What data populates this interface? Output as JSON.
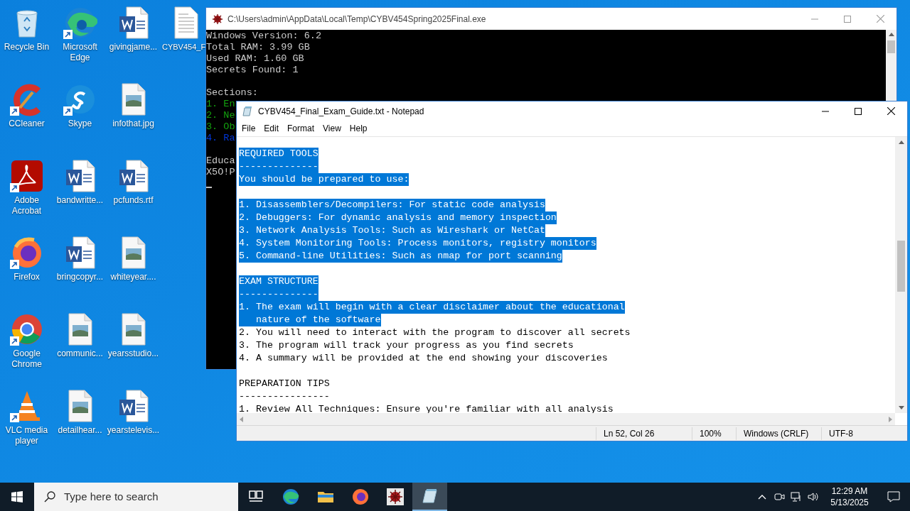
{
  "desktop_icons": [
    {
      "label": "Recycle Bin",
      "kind": "recycle",
      "shortcut": false
    },
    {
      "label": "CCleaner",
      "kind": "ccleaner",
      "shortcut": true
    },
    {
      "label": "Adobe Acrobat",
      "kind": "acrobat",
      "shortcut": true
    },
    {
      "label": "Firefox",
      "kind": "firefox",
      "shortcut": true
    },
    {
      "label": "Google Chrome",
      "kind": "chrome",
      "shortcut": true
    },
    {
      "label": "VLC media player",
      "kind": "vlc",
      "shortcut": true
    },
    {
      "label": "Microsoft Edge",
      "kind": "edge",
      "shortcut": true
    },
    {
      "label": "Skype",
      "kind": "skype",
      "shortcut": true
    },
    {
      "label": "bandwritte...",
      "kind": "word",
      "shortcut": false
    },
    {
      "label": "bringcopyr...",
      "kind": "word",
      "shortcut": false
    },
    {
      "label": "communic...",
      "kind": "image",
      "shortcut": false
    },
    {
      "label": "detailhear...",
      "kind": "image",
      "shortcut": false
    },
    {
      "label": "givingjame...",
      "kind": "word",
      "shortcut": false
    },
    {
      "label": "infothat.jpg",
      "kind": "image",
      "shortcut": false
    },
    {
      "label": "pcfunds.rtf",
      "kind": "word",
      "shortcut": false
    },
    {
      "label": "whiteyear....",
      "kind": "image",
      "shortcut": false
    },
    {
      "label": "yearsstudio...",
      "kind": "image",
      "shortcut": false
    },
    {
      "label": "yearstelevis...",
      "kind": "word",
      "shortcut": false
    },
    {
      "label": "CYBV454_F",
      "kind": "text",
      "shortcut": false
    }
  ],
  "console": {
    "title": "C:\\Users\\admin\\AppData\\Local\\Temp\\CYBV454Spring2025Final.exe",
    "blocks": [
      [
        {
          "text": "Windows Version: 6.2",
          "kind": "plain"
        },
        {
          "text": "Total RAM: 3.99 GB",
          "kind": "plain"
        },
        {
          "text": "Used RAM: 1.60 GB",
          "kind": "plain"
        },
        {
          "text": "Secrets Found: 1",
          "kind": "plain"
        }
      ],
      [
        {
          "text": "Sections:",
          "kind": "plain"
        },
        {
          "text": "1. En",
          "kind": "section"
        },
        {
          "text": "2. Ne",
          "kind": "section"
        },
        {
          "text": "3. Ob",
          "kind": "section"
        },
        {
          "text": "4. Ra",
          "kind": "pending"
        }
      ],
      [
        {
          "text": "Educa",
          "kind": "plain"
        },
        {
          "text": "X5O!P",
          "kind": "plain"
        }
      ]
    ]
  },
  "notepad": {
    "title": "CYBV454_Final_Exam_Guide.txt - Notepad",
    "menu": [
      "File",
      "Edit",
      "Format",
      "View",
      "Help"
    ],
    "blocks": [
      [
        {
          "text": "REQUIRED TOOLS",
          "selected": true
        },
        {
          "text": "--------------",
          "selected": true
        },
        {
          "text": "You should be prepared to use:",
          "selected": true
        }
      ],
      [
        {
          "text": "1. Disassemblers/Decompilers: For static code analysis",
          "selected": true
        },
        {
          "text": "2. Debuggers: For dynamic analysis and memory inspection",
          "selected": true
        },
        {
          "text": "3. Network Analysis Tools: Such as Wireshark or NetCat",
          "selected": true
        },
        {
          "text": "4. System Monitoring Tools: Process monitors, registry monitors",
          "selected": true
        },
        {
          "text": "5. Command-line Utilities: Such as nmap for port scanning",
          "selected": true
        }
      ],
      [
        {
          "text": "EXAM STRUCTURE",
          "selected": true
        },
        {
          "text": "--------------",
          "selected": true
        },
        {
          "text": "1. The exam will begin with a clear disclaimer about the educational",
          "selected": true
        },
        {
          "text": "   nature of the software",
          "selected": true
        },
        {
          "text": "2. You will need to interact with the program to discover all secrets",
          "selected": false
        },
        {
          "text": "3. The program will track your progress as you find secrets",
          "selected": false
        },
        {
          "text": "4. A summary will be provided at the end showing your discoveries",
          "selected": false
        }
      ],
      [
        {
          "text": "PREPARATION TIPS",
          "selected": false
        },
        {
          "text": "----------------",
          "selected": false
        },
        {
          "text": "1. Review All Techniques: Ensure you're familiar with all analysis",
          "selected": false
        }
      ]
    ],
    "status": [
      "Ln 52, Col 26",
      "100%",
      "Windows (CRLF)",
      "UTF-8"
    ]
  },
  "taskbar": {
    "search_placeholder": "Type here to search",
    "apps": [
      {
        "kind": "taskview",
        "active": false
      },
      {
        "kind": "edge",
        "active": false
      },
      {
        "kind": "explorer",
        "active": false
      },
      {
        "kind": "firefox",
        "active": false
      },
      {
        "kind": "bug",
        "active": false
      },
      {
        "kind": "notepad",
        "active": true
      }
    ],
    "time": "12:29 AM",
    "date": "5/13/2025"
  }
}
